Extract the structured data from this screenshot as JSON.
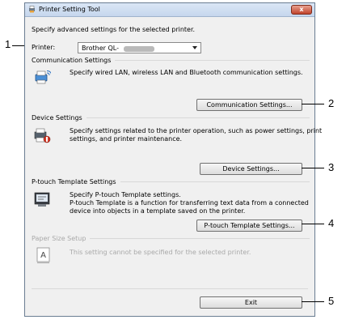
{
  "window": {
    "title": "Printer Setting Tool",
    "close_glyph": "x"
  },
  "intro": "Specify advanced settings for the selected printer.",
  "printer": {
    "label": "Printer:",
    "value": "Brother QL-"
  },
  "communication": {
    "header": "Communication Settings",
    "description": "Specify wired LAN, wireless LAN and Bluetooth communication settings.",
    "button": "Communication Settings..."
  },
  "device": {
    "header": "Device Settings",
    "description_line1": "Specify settings related to the printer operation, such as power settings, print",
    "description_line2": "settings, and printer maintenance.",
    "button": "Device Settings..."
  },
  "ptouch": {
    "header": "P-touch Template Settings",
    "description_line1": "Specify P-touch Template settings.",
    "description_line2": "P-touch Template is a function for transferring text data from a connected",
    "description_line3": "device into objects in a template saved on the printer.",
    "button": "P-touch Template Settings..."
  },
  "paper": {
    "header": "Paper Size Setup",
    "description": "This setting cannot be specified for the selected printer.",
    "icon_letter": "A"
  },
  "exit_button": "Exit",
  "callouts": [
    "1",
    "2",
    "3",
    "4",
    "5"
  ],
  "icons": {
    "title": "printer-icon",
    "communication": "network-printer-icon",
    "device": "printer-settings-icon",
    "ptouch": "template-icon",
    "paper": "paper-size-icon"
  }
}
